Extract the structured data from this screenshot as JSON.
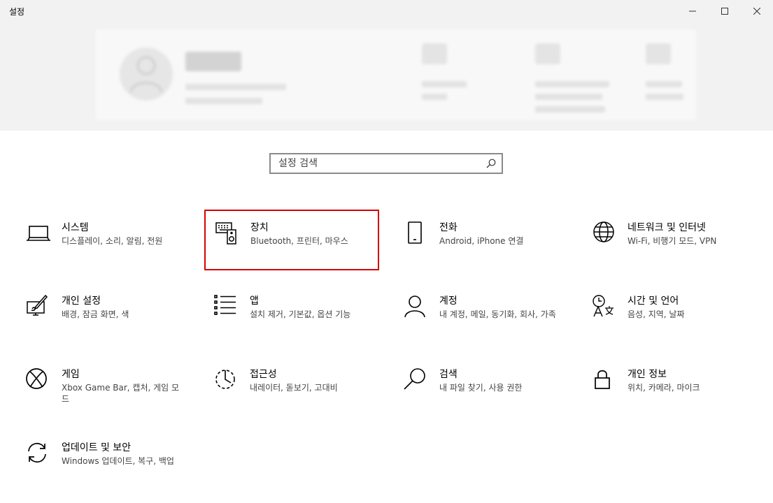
{
  "window": {
    "title": "설정"
  },
  "search": {
    "placeholder": "설정 검색"
  },
  "tiles": [
    {
      "id": "system",
      "title": "시스템",
      "desc": "디스플레이, 소리, 알림, 전원",
      "icon": "laptop-icon"
    },
    {
      "id": "devices",
      "title": "장치",
      "desc": "Bluetooth, 프린터, 마우스",
      "icon": "keyboard-speaker-icon",
      "selected": true
    },
    {
      "id": "phone",
      "title": "전화",
      "desc": "Android, iPhone 연결",
      "icon": "phone-icon"
    },
    {
      "id": "network",
      "title": "네트워크 및 인터넷",
      "desc": "Wi-Fi, 비행기 모드, VPN",
      "icon": "globe-icon"
    },
    {
      "id": "personalization",
      "title": "개인 설정",
      "desc": "배경, 잠금 화면, 색",
      "icon": "paint-display-icon"
    },
    {
      "id": "apps",
      "title": "앱",
      "desc": "설치 제거, 기본값, 옵션 기능",
      "icon": "apps-list-icon"
    },
    {
      "id": "accounts",
      "title": "계정",
      "desc": "내 계정, 메일, 동기화, 회사, 가족",
      "icon": "person-icon"
    },
    {
      "id": "time-language",
      "title": "시간 및 언어",
      "desc": "음성, 지역, 날짜",
      "icon": "time-language-icon"
    },
    {
      "id": "gaming",
      "title": "게임",
      "desc": "Xbox Game Bar, 캡처, 게임 모드",
      "icon": "xbox-icon"
    },
    {
      "id": "ease-of-access",
      "title": "접근성",
      "desc": "내레이터, 돋보기, 고대비",
      "icon": "ease-of-access-icon"
    },
    {
      "id": "search",
      "title": "검색",
      "desc": "내 파일 찾기, 사용 권한",
      "icon": "magnifier-icon"
    },
    {
      "id": "privacy",
      "title": "개인 정보",
      "desc": "위치, 카메라, 마이크",
      "icon": "lock-icon"
    },
    {
      "id": "update-security",
      "title": "업데이트 및 보안",
      "desc": "Windows 업데이트, 복구, 백업",
      "icon": "sync-icon"
    }
  ],
  "colors": {
    "selection_border": "#d60000",
    "header_bg": "#f2f2f2"
  }
}
